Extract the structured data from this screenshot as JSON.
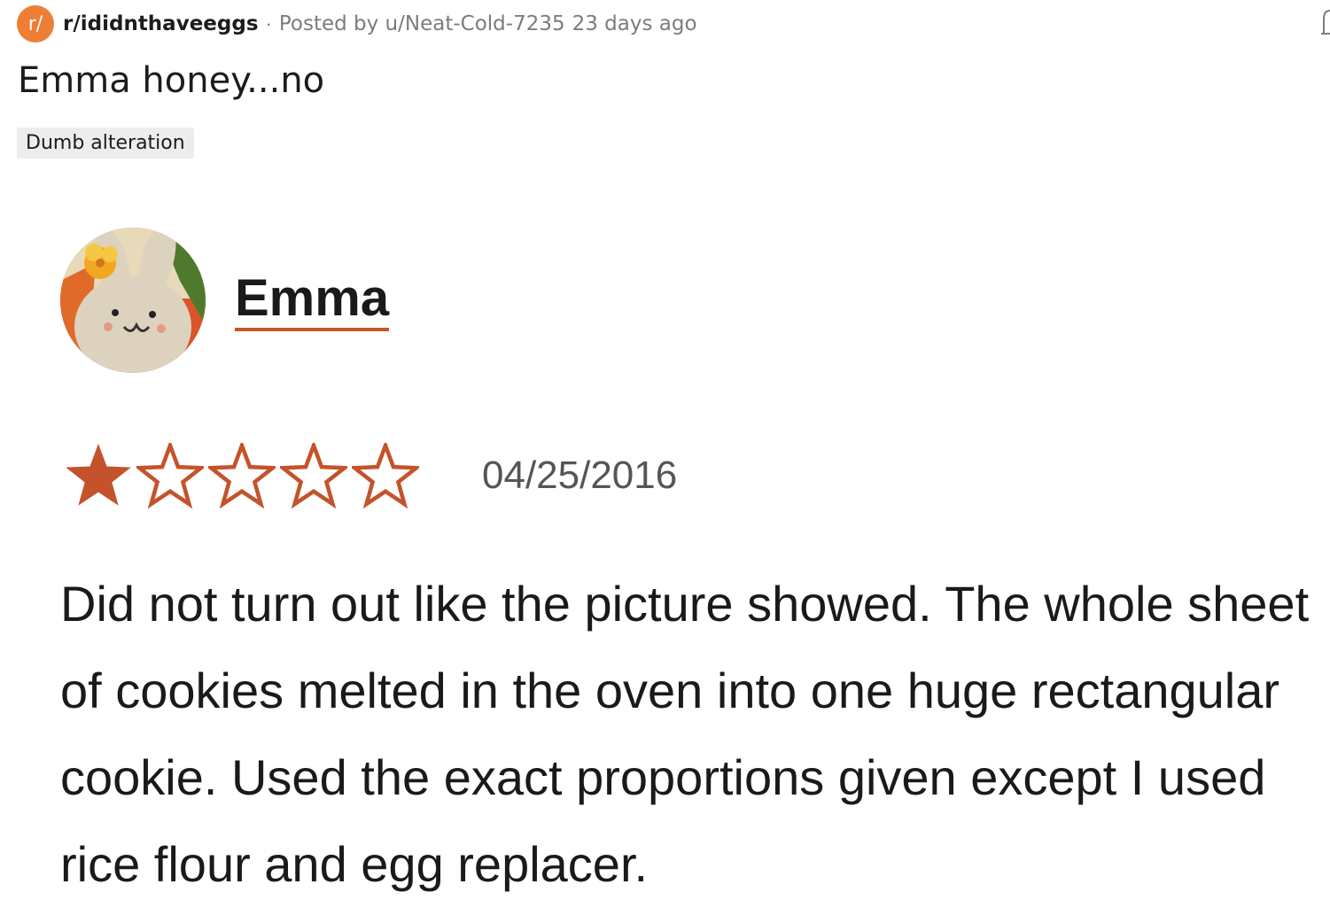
{
  "post": {
    "subreddit_icon": "r/",
    "subreddit": "r/ididnthaveeggs",
    "separator": "·",
    "posted_by": "Posted by u/Neat-Cold-7235",
    "age": "23 days ago",
    "title": "Emma honey...no",
    "flair": "Dumb alteration"
  },
  "review": {
    "reviewer_name": "Emma",
    "rating": 1,
    "max_rating": 5,
    "date": "04/25/2016",
    "text": "Did not turn out like the picture showed. The whole sheet of cookies melted in the oven into one huge rectangular cookie. Used the exact proportions given except I used rice flour and egg replacer."
  },
  "colors": {
    "subreddit_icon_bg": "#ef7e35",
    "star_color": "#c4532b",
    "name_underline": "#c15a2a",
    "flair_bg": "#ededed",
    "meta_text": "#7c7c7c"
  },
  "icons": {
    "share": "share-icon",
    "star_filled": "star-filled-icon",
    "star_empty": "star-outline-icon"
  }
}
